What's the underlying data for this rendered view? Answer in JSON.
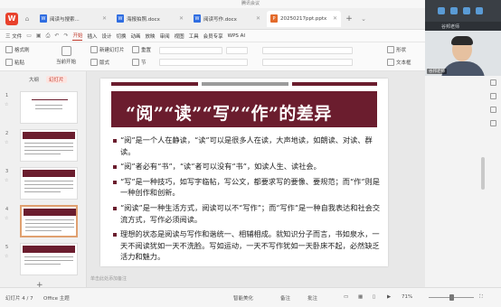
{
  "meeting": {
    "title": "腾讯会议"
  },
  "tabs": [
    {
      "label": "阅读与搜索...",
      "type": "w"
    },
    {
      "label": "海报拍照.docx",
      "type": "w"
    },
    {
      "label": "阅读写作.docx",
      "type": "w"
    },
    {
      "label": "20250217ppt.pptx",
      "type": "p"
    }
  ],
  "menu": {
    "file": "三 文件",
    "items": [
      "开始",
      "插入",
      "设计",
      "切换",
      "动画",
      "放映",
      "审阅",
      "视图",
      "工具",
      "会员专享"
    ],
    "ai": "WPS AI"
  },
  "toolbar": {
    "format_painter": "格式刷",
    "paste": "粘贴",
    "from_current": "当前开始",
    "new_slide": "新建幻灯片",
    "layout": "版式",
    "reset": "重置",
    "sections": "节",
    "shape": "形状",
    "textbox": "文本框"
  },
  "video": {
    "name": "谷邦老师",
    "caption": "谷邦老师"
  },
  "left_panel": {
    "tab_outline": "大纲",
    "tab_slides": "幻灯片",
    "slides": [
      "1",
      "2",
      "3",
      "4",
      "5"
    ]
  },
  "slide": {
    "title": "“阅”“读”“写”“作”的差异",
    "bullets": [
      "“阅”是一个人在静读，“读”可以是很多人在读，大声地读，如朗读、对读、群读。",
      "“阅”者必有“书”，“读”者可以没有“书”，如读人生、读社会。",
      "“写”是一种技巧，如写字临帖，写公文，都要求写的要像、要规范；而“作”则是一种创作和创新。",
      "“阅读”是一种生活方式，阅读可以不“写作”；而“写作”是一种自我表达和社会交流方式，写作必须阅读。",
      "理想的状态是阅读与写作和谐统一、相辅相成。就知识分子而言，书如泉水，一天不阅读犹如一天不洗脸。写如运动，一天不写作犹如一天卧床不起，必然缺乏活力和魅力。"
    ],
    "notes": "单击此处添加备注"
  },
  "status": {
    "slide_count": "幻灯片 4 / 7",
    "theme": "Office 主题",
    "smart": "智能美化",
    "notes": "备注",
    "comments": "批注",
    "zoom": "71%"
  },
  "colors": {
    "accent": "#6b1d2e",
    "wps_red": "#e8412c"
  }
}
